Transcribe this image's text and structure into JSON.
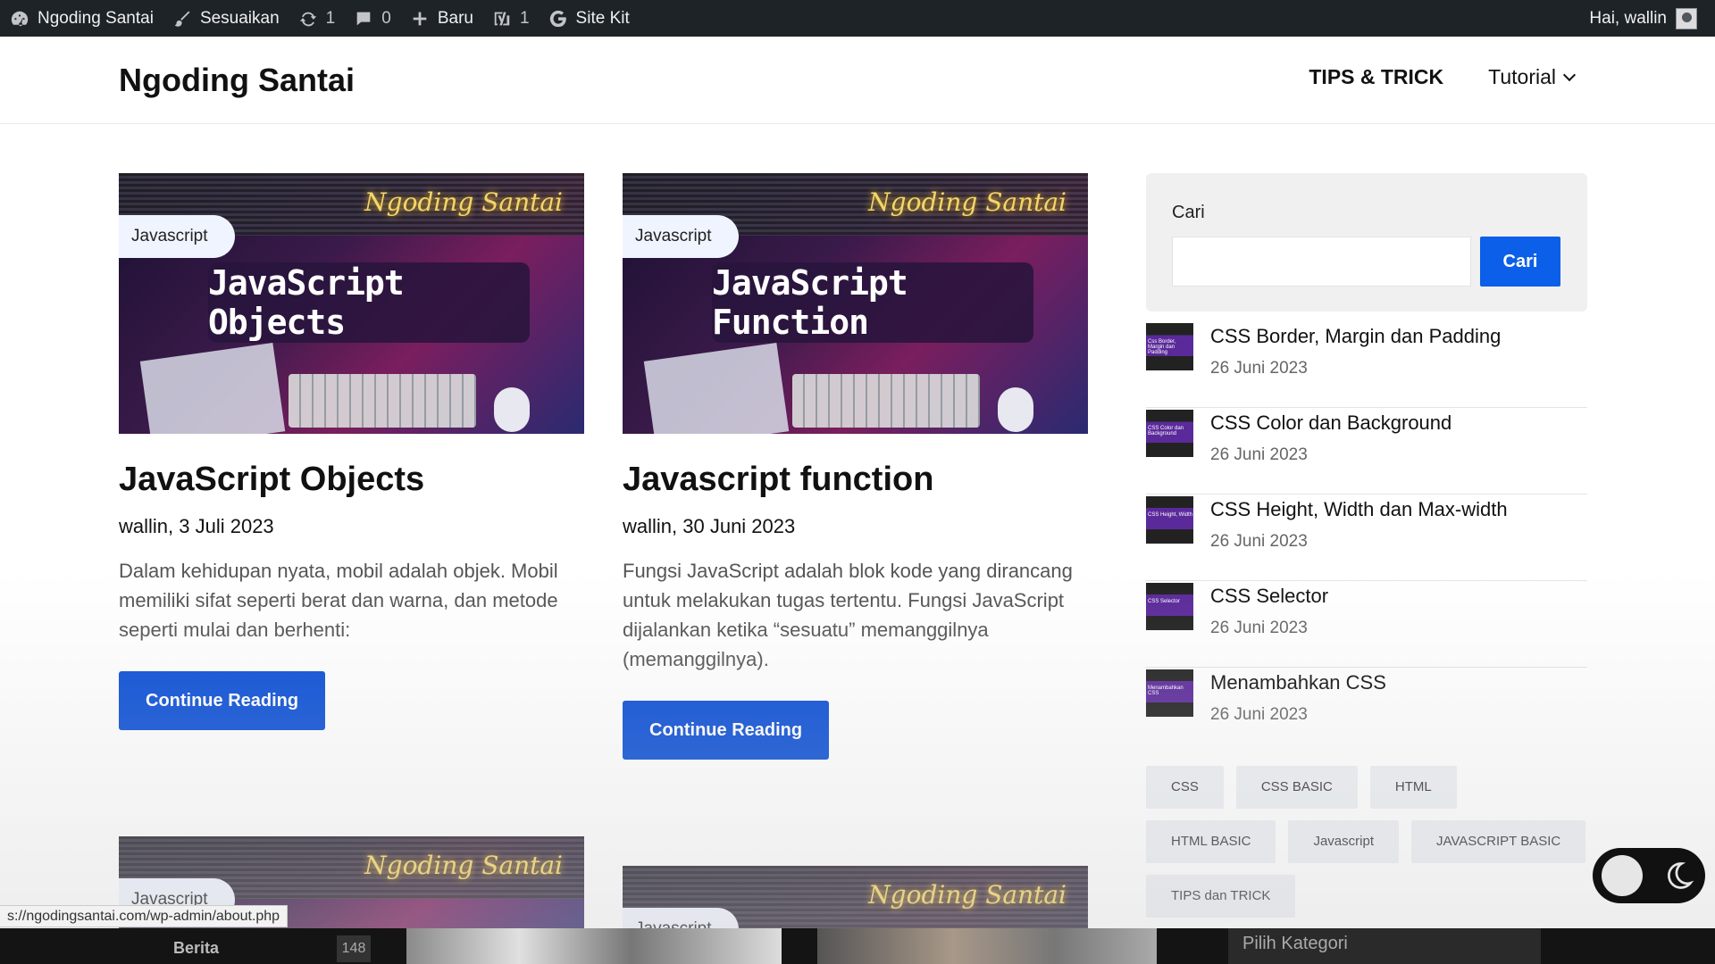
{
  "adminbar": {
    "site_name": "Ngoding Santai",
    "customize": "Sesuaikan",
    "updates_count": "1",
    "comments_count": "0",
    "new_label": "Baru",
    "yoast_count": "1",
    "sitekit_label": "Site Kit",
    "greeting": "Hai, wallin"
  },
  "header": {
    "site_title": "Ngoding Santai",
    "menu": [
      {
        "label": "TIPS & TRICK"
      },
      {
        "label": "Tutorial"
      }
    ]
  },
  "posts": [
    {
      "category": "Javascript",
      "thumb_text": "JavaScript Objects",
      "brand": "Ngoding Santai",
      "title": "JavaScript Objects",
      "meta": "wallin, 3 Juli 2023",
      "excerpt": "Dalam kehidupan nyata, mobil adalah objek. Mobil memiliki sifat seperti berat dan warna, dan metode seperti mulai dan berhenti:",
      "button": "Continue Reading"
    },
    {
      "category": "Javascript",
      "thumb_text": "JavaScript Function",
      "brand": "Ngoding Santai",
      "title": "Javascript function",
      "meta": "wallin, 30 Juni 2023",
      "excerpt": "Fungsi JavaScript adalah blok kode yang dirancang untuk melakukan tugas tertentu. Fungsi JavaScript dijalankan ketika “sesuatu” memanggilnya (memanggilnya).",
      "button": "Continue Reading"
    },
    {
      "category": "Javascript",
      "brand": "Ngoding Santai"
    },
    {
      "category": "Javascript",
      "brand": "Ngoding Santai"
    }
  ],
  "sidebar": {
    "search_label": "Cari",
    "search_value": "",
    "search_button": "Cari",
    "recent": [
      {
        "title": "CSS Border, Margin dan Padding",
        "date": "26 Juni 2023",
        "thumb_text": "Css Border, Margin dan Padding"
      },
      {
        "title": "CSS Color dan Background",
        "date": "26 Juni 2023",
        "thumb_text": "CSS Color dan Background"
      },
      {
        "title": "CSS Height, Width dan Max-width",
        "date": "26 Juni 2023",
        "thumb_text": "CSS Height, Width"
      },
      {
        "title": "CSS Selector",
        "date": "26 Juni 2023",
        "thumb_text": "CSS Selector"
      },
      {
        "title": "Menambahkan CSS",
        "date": "26 Juni 2023",
        "thumb_text": "Menambahkan CSS"
      }
    ],
    "tags": [
      "CSS",
      "CSS BASIC",
      "HTML",
      "HTML BASIC",
      "Javascript",
      "JAVASCRIPT BASIC",
      "TIPS dan TRICK"
    ]
  },
  "statusbar": {
    "url": "s://ngodingsantai.com/wp-admin/about.php"
  },
  "bottom": {
    "berita": "Berita",
    "count": "148",
    "kategori": "Pilih Kategori"
  },
  "colors": {
    "adminbar": "#1d2327",
    "primary_button": "#0b4fd6",
    "search_button": "#0b5fe8"
  }
}
